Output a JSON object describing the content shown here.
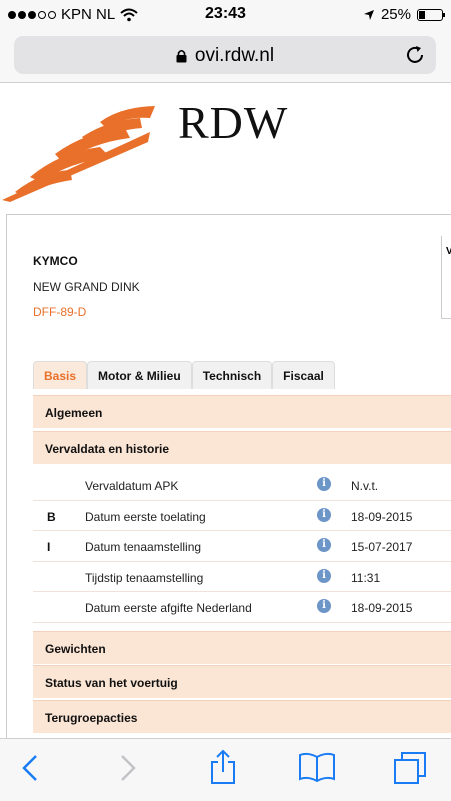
{
  "status_bar": {
    "carrier": "KPN NL",
    "time": "23:43",
    "battery": "25%"
  },
  "browser": {
    "url": "ovi.rdw.nl"
  },
  "logo": {
    "text": "RDW",
    "color": "#e8702a"
  },
  "vehicle": {
    "brand": "KYMCO",
    "model": "NEW GRAND DINK",
    "plate": "DFF-89-D",
    "side_panel_label": "V"
  },
  "tabs": [
    {
      "label": "Basis",
      "active": true
    },
    {
      "label": "Motor & Milieu",
      "active": false
    },
    {
      "label": "Technisch",
      "active": false
    },
    {
      "label": "Fiscaal",
      "active": false
    }
  ],
  "sections": {
    "algemeen": "Algemeen",
    "vervaldata": "Vervaldata en historie",
    "gewichten": "Gewichten",
    "status": "Status van het voertuig",
    "terugroep": "Terugroepacties"
  },
  "rows": [
    {
      "code": "",
      "label": "Vervaldatum APK",
      "info": "i",
      "value": "N.v.t."
    },
    {
      "code": "B",
      "label": "Datum eerste toelating",
      "info": "i",
      "value": "18-09-2015"
    },
    {
      "code": "I",
      "label": "Datum tenaamstelling",
      "info": "i",
      "value": "15-07-2017"
    },
    {
      "code": "",
      "label": "Tijdstip tenaamstelling",
      "info": "i",
      "value": "11:31"
    },
    {
      "code": "",
      "label": "Datum eerste afgifte Nederland",
      "info": "i",
      "value": "18-09-2015"
    }
  ],
  "icons": {
    "back": "chevron-left-icon",
    "forward": "chevron-right-icon",
    "share": "share-icon",
    "bookmarks": "book-icon",
    "tabs": "tabs-icon"
  },
  "colors": {
    "accent": "#e8702a",
    "ios_blue": "#1a7cf5",
    "section_bg": "#fbe5d5",
    "info": "#6c95c8"
  }
}
